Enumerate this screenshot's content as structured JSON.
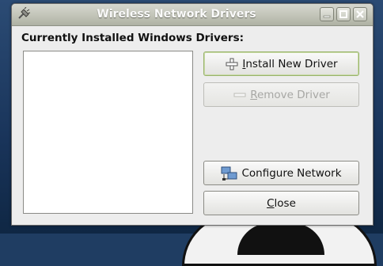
{
  "window": {
    "title": "Wireless Network Drivers",
    "controls": [
      "minimize",
      "maximize",
      "close"
    ]
  },
  "heading": "Currently Installed Windows Drivers:",
  "driver_list": {
    "items": []
  },
  "buttons": {
    "install": {
      "mnemonic": "I",
      "rest": "nstall New Driver",
      "icon": "plus-icon",
      "enabled": true
    },
    "remove": {
      "mnemonic": "R",
      "rest": "emove Driver",
      "icon": "minus-icon",
      "enabled": false
    },
    "configure": {
      "label": "Configure Network",
      "icon": "network-icon",
      "enabled": true
    },
    "close": {
      "mnemonic": "C",
      "rest": "lose",
      "enabled": true
    }
  },
  "colors": {
    "titlebar": "#c2c4b8",
    "title_text": "#fafafa",
    "window_bg": "#ededed",
    "default_border": "#99b36b"
  }
}
